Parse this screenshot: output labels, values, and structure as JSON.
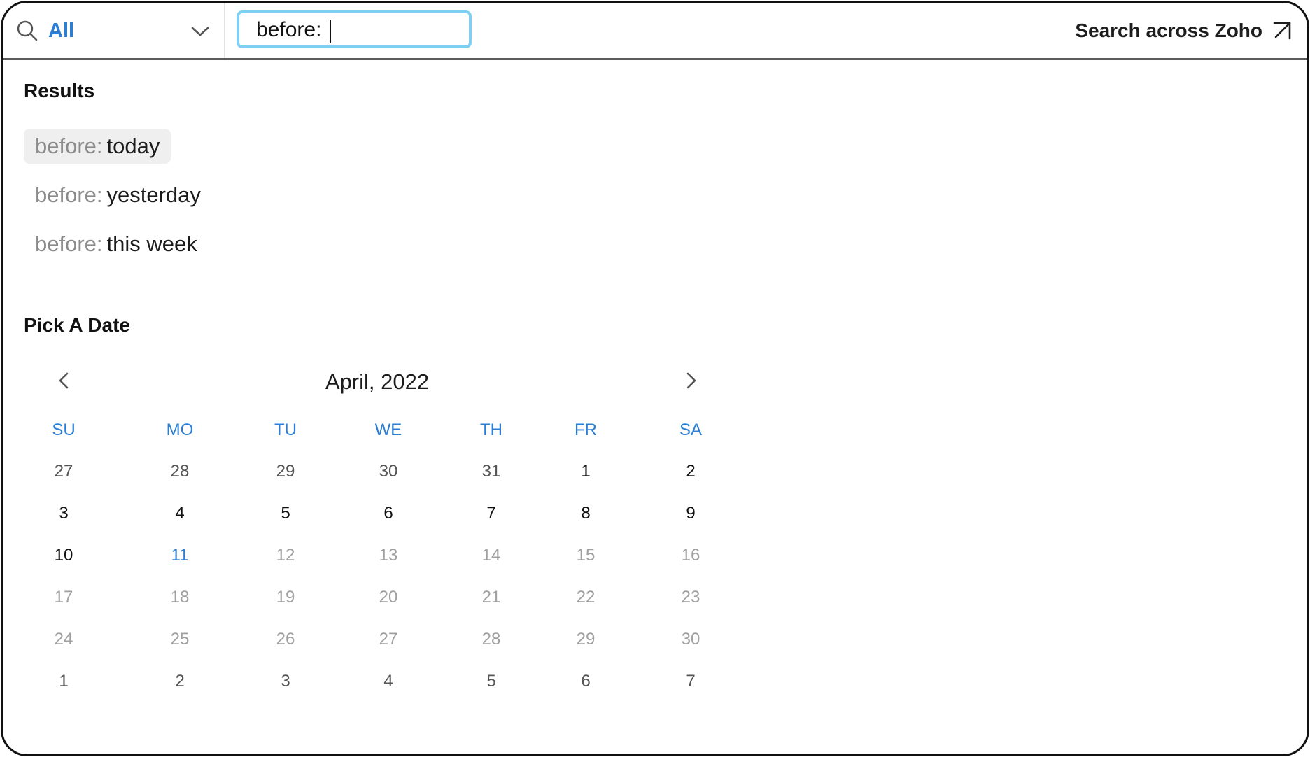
{
  "header": {
    "scope_label": "All",
    "search_value": "before:",
    "across_label": "Search across Zoho"
  },
  "results": {
    "title": "Results",
    "items": [
      {
        "prefix": "before:",
        "term": "today",
        "active": true
      },
      {
        "prefix": "before:",
        "term": "yesterday",
        "active": false
      },
      {
        "prefix": "before:",
        "term": "this week",
        "active": false
      }
    ]
  },
  "date_picker": {
    "title": "Pick A Date",
    "month_label": "April, 2022",
    "weekdays": [
      "SU",
      "MO",
      "TU",
      "WE",
      "TH",
      "FR",
      "SA"
    ],
    "today": 11,
    "weeks": [
      [
        "27",
        "28",
        "29",
        "30",
        "31",
        "1",
        "2"
      ],
      [
        "3",
        "4",
        "5",
        "6",
        "7",
        "8",
        "9"
      ],
      [
        "10",
        "11",
        "12",
        "13",
        "14",
        "15",
        "16"
      ],
      [
        "17",
        "18",
        "19",
        "20",
        "21",
        "22",
        "23"
      ],
      [
        "24",
        "25",
        "26",
        "27",
        "28",
        "29",
        "30"
      ],
      [
        "1",
        "2",
        "3",
        "4",
        "5",
        "6",
        "7"
      ]
    ]
  },
  "colors": {
    "accent": "#2a7fd4",
    "focus_border": "#7ed0f2",
    "muted_text": "#a0a0a0"
  },
  "icons": {
    "scope": "search-icon",
    "dropdown": "chevron-down-icon",
    "across": "arrow-up-right-icon",
    "prev": "chevron-left-icon",
    "next": "chevron-right-icon"
  }
}
